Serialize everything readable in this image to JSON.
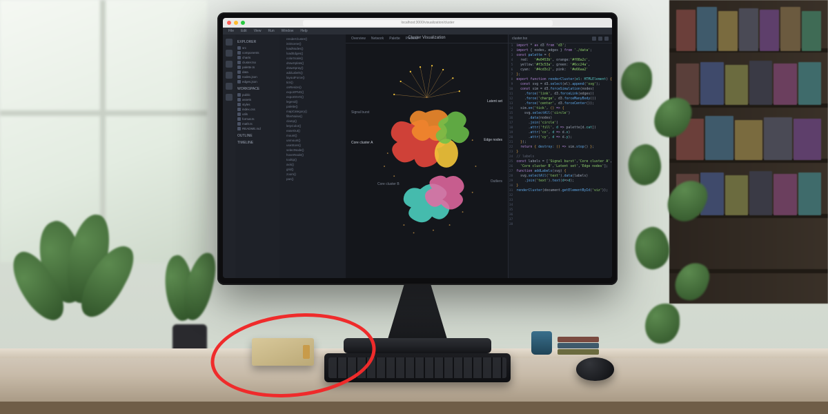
{
  "scene": {
    "description": "Photorealistic render of a desktop computer on a wooden desk near a window with houseplants and a bookshelf. The monitor shows a dark-themed IDE with a file tree, an abstract colored splatter network visualization in the center, and a code panel on the right. A small beige box on the desk is circled with a red hand-drawn ellipse annotation.",
    "annotation": "red-ellipse-around-box-on-desk"
  },
  "titlebar": {
    "traffic_lights": [
      "#ff5f57",
      "#febc2e",
      "#28c840"
    ],
    "address": "localhost:3000/visualization/cluster"
  },
  "menubar": {
    "items": [
      "File",
      "Edit",
      "View",
      "Run",
      "Window",
      "Help"
    ]
  },
  "rail_icons": [
    "files-icon",
    "search-icon",
    "branch-icon",
    "debug-icon",
    "extensions-icon",
    "settings-icon"
  ],
  "tree": {
    "heading_a": "EXPLORER",
    "heading_b": "WORKSPACE",
    "items_a": [
      "src",
      "components",
      "charts",
      "cluster.tsx",
      "palette.ts",
      "data",
      "nodes.json",
      "edges.json"
    ],
    "items_b": [
      "public",
      "assets",
      "styles",
      "index.css",
      "utils",
      "format.ts",
      "math.ts",
      "README.md"
    ],
    "heading_c": "OUTLINE",
    "heading_d": "TIMELINE"
  },
  "outline_rows": [
    "renderCluster()",
    "initScene()",
    "loadNodes()",
    "loadEdges()",
    "colorScale()",
    "drawSplats()",
    "drawSpray()",
    "addLabels()",
    "layoutForce()",
    "tick()",
    "onResize()",
    "exportPNG()",
    "exportSVG()",
    "legend()",
    "palette()",
    "mapCategory()",
    "filterNoise()",
    "clamp()",
    "lerpColor()",
    "easeOut()",
    "mount()",
    "unmount()",
    "useStore()",
    "selectNode()",
    "hoverNode()",
    "tooltip()",
    "axis()",
    "grid()",
    "zoom()",
    "pan()"
  ],
  "center": {
    "title": "Cluster Visualization",
    "tabs": [
      "Overview",
      "Network",
      "Palette",
      "Preview"
    ],
    "labels": {
      "a": "Signal burst",
      "b": "Core cluster A",
      "c": "Core cluster B",
      "d": "Latent set",
      "e": "Edge nodes",
      "f": "Outliers"
    },
    "splat_colors": {
      "red": "#e0453b",
      "orange": "#f08a2c",
      "yellow": "#f3c53a",
      "green": "#6cc24a",
      "cyan": "#4cd3c2",
      "pink": "#e66aa2"
    }
  },
  "code": {
    "filename": "cluster.tsx",
    "toolbar_icons": [
      "split-icon",
      "more-icon",
      "close-icon"
    ],
    "line_start": 1,
    "lines": [
      [
        "k-purple",
        "import",
        " * ",
        "k-purple",
        "as",
        " d3 ",
        "k-purple",
        "from",
        " ",
        "k-green",
        "'d3'",
        ";"
      ],
      [
        "k-purple",
        "import",
        " { nodes, edges } ",
        "k-purple",
        "from",
        " ",
        "k-green",
        "'./data'",
        ";"
      ],
      [
        ""
      ],
      [
        "k-purple",
        "const",
        " ",
        "k-blue",
        "palette",
        " = ",
        "k-orange",
        "{"
      ],
      [
        "  red:   ",
        "k-green",
        "'#e0453b'",
        ",",
        " orange:",
        "k-green",
        "'#f08a2c'",
        ","
      ],
      [
        "  yellow:",
        "k-green",
        "'#f3c53a'",
        ",",
        " green: ",
        "k-green",
        "'#6cc24a'",
        ","
      ],
      [
        "  cyan:  ",
        "k-green",
        "'#4cd3c2'",
        ",",
        " pink:  ",
        "k-green",
        "'#e66aa2'"
      ],
      [
        "k-orange",
        "}",
        ";"
      ],
      [
        ""
      ],
      [
        "k-purple",
        "export function",
        " ",
        "k-blue",
        "renderCluster",
        "(",
        "k-cyan",
        "el",
        ": ",
        "k-cyan",
        "HTMLElement",
        ") ",
        "k-orange",
        "{"
      ],
      [
        "  ",
        "k-purple",
        "const",
        " svg = d3.",
        "k-blue",
        "select",
        "(el).",
        "k-blue",
        "append",
        "(",
        "k-green",
        "'svg'",
        ");"
      ],
      [
        "  ",
        "k-purple",
        "const",
        " sim = d3.",
        "k-blue",
        "forceSimulation",
        "(nodes)"
      ],
      [
        "    .",
        "k-blue",
        "force",
        "(",
        "k-green",
        "'link'",
        ", d3.",
        "k-blue",
        "forceLink",
        "(edges))"
      ],
      [
        "    .",
        "k-blue",
        "force",
        "(",
        "k-green",
        "'charge'",
        ", d3.",
        "k-blue",
        "forceManyBody",
        "())"
      ],
      [
        "    .",
        "k-blue",
        "force",
        "(",
        "k-green",
        "'center'",
        ", d3.",
        "k-blue",
        "forceCenter",
        "());"
      ],
      [
        ""
      ],
      [
        "  sim.",
        "k-blue",
        "on",
        "(",
        "k-green",
        "'tick'",
        ", ",
        "k-orange",
        "()",
        " ",
        "k-purple",
        "=>",
        " ",
        "k-orange",
        "{"
      ],
      [
        "    svg.",
        "k-blue",
        "selectAll",
        "(",
        "k-green",
        "'circle'",
        ")"
      ],
      [
        "      .",
        "k-blue",
        "data",
        "(nodes)"
      ],
      [
        "      .",
        "k-blue",
        "join",
        "(",
        "k-green",
        "'circle'",
        ")"
      ],
      [
        "      .",
        "k-blue",
        "attr",
        "(",
        "k-green",
        "'fill'",
        ", ",
        "k-cyan",
        "d",
        " ",
        "k-purple",
        "=>",
        " palette[d.",
        "k-cyan",
        "cat",
        "])"
      ],
      [
        "      .",
        "k-blue",
        "attr",
        "(",
        "k-green",
        "'cx'",
        ", ",
        "k-cyan",
        "d",
        " ",
        "k-purple",
        "=>",
        " d.",
        "k-cyan",
        "x",
        ")"
      ],
      [
        "      .",
        "k-blue",
        "attr",
        "(",
        "k-green",
        "'cy'",
        ", ",
        "k-cyan",
        "d",
        " ",
        "k-purple",
        "=>",
        " d.",
        "k-cyan",
        "y",
        ");"
      ],
      [
        "  ",
        "k-orange",
        "}",
        ");"
      ],
      [
        ""
      ],
      [
        "  ",
        "k-purple",
        "return",
        " ",
        "k-orange",
        "{",
        " ",
        "k-blue",
        "destroy",
        ": ",
        "k-orange",
        "()",
        " ",
        "k-purple",
        "=>",
        " sim.",
        "k-blue",
        "stop",
        "() ",
        "k-orange",
        "}",
        ";"
      ],
      [
        "k-orange",
        "}"
      ],
      [
        ""
      ],
      [
        "k-gray",
        "// labels"
      ],
      [
        "k-purple",
        "const",
        " labels = [",
        "k-green",
        "'Signal burst'",
        ",",
        "k-green",
        "'Core cluster A'",
        ","
      ],
      [
        "  ",
        "k-green",
        "'Core cluster B'",
        ",",
        "k-green",
        "'Latent set'",
        ",",
        "k-green",
        "'Edge nodes'",
        "];"
      ],
      [
        ""
      ],
      [
        "k-purple",
        "function",
        " ",
        "k-blue",
        "addLabels",
        "(svg) ",
        "k-orange",
        "{"
      ],
      [
        "  svg.",
        "k-blue",
        "selectAll",
        "(",
        "k-green",
        "'text'",
        ").",
        "k-blue",
        "data",
        "(labels)"
      ],
      [
        "    .",
        "k-blue",
        "join",
        "(",
        "k-green",
        "'text'",
        ").",
        "k-blue",
        "text",
        "(",
        "k-cyan",
        "d",
        "=>",
        "k-cyan",
        "d",
        ");"
      ],
      [
        "k-orange",
        "}"
      ],
      [
        ""
      ],
      [
        "k-blue",
        "renderCluster",
        "(document.",
        "k-blue",
        "getElementById",
        "(",
        "k-green",
        "'viz'",
        "));"
      ]
    ]
  }
}
